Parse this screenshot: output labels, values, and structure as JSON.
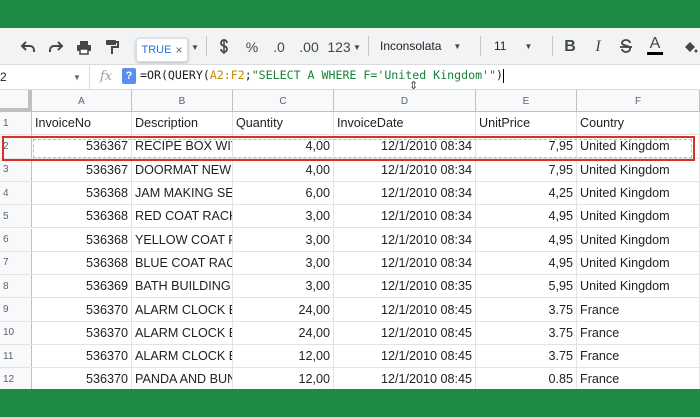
{
  "toolbar": {
    "chip_value": "TRUE",
    "chip_close": "×",
    "percent": "%",
    "dec_less": ".0",
    "dec_more": ".00",
    "number_format": "123",
    "font_name": "Inconsolata",
    "font_size": "11",
    "bold": "B",
    "italic": "I",
    "underline_letter": "A"
  },
  "formula_bar": {
    "name_box": "2",
    "fx": "fx",
    "help": "?",
    "formula_prefix": "=OR(QUERY(",
    "formula_range": "A2:F2",
    "formula_mid": ";",
    "formula_string": "\"SELECT A WHERE F='United Kingdom'\"",
    "formula_suffix": ")"
  },
  "columns": [
    "A",
    "B",
    "C",
    "D",
    "E",
    "F"
  ],
  "rows": [
    {
      "num": "1",
      "cells": [
        "InvoiceNo",
        "Description",
        "Quantity",
        "InvoiceDate",
        "UnitPrice",
        "Country"
      ]
    },
    {
      "num": "2",
      "cells": [
        "536367",
        "RECIPE BOX WIT",
        "4,00",
        "12/1/2010 08:34",
        "7,95",
        "United Kingdom"
      ]
    },
    {
      "num": "3",
      "cells": [
        "536367",
        "DOORMAT NEW",
        "4,00",
        "12/1/2010 08:34",
        "7,95",
        "United Kingdom"
      ]
    },
    {
      "num": "4",
      "cells": [
        "536368",
        "JAM MAKING SE",
        "6,00",
        "12/1/2010 08:34",
        "4,25",
        "United Kingdom"
      ]
    },
    {
      "num": "5",
      "cells": [
        "536368",
        "RED COAT RACK",
        "3,00",
        "12/1/2010 08:34",
        "4,95",
        "United Kingdom"
      ]
    },
    {
      "num": "6",
      "cells": [
        "536368",
        "YELLOW COAT R",
        "3,00",
        "12/1/2010 08:34",
        "4,95",
        "United Kingdom"
      ]
    },
    {
      "num": "7",
      "cells": [
        "536368",
        "BLUE COAT RACK",
        "3,00",
        "12/1/2010 08:34",
        "4,95",
        "United Kingdom"
      ]
    },
    {
      "num": "8",
      "cells": [
        "536369",
        "BATH BUILDING",
        "3,00",
        "12/1/2010 08:35",
        "5,95",
        "United Kingdom"
      ]
    },
    {
      "num": "9",
      "cells": [
        "536370",
        "ALARM CLOCK B",
        "24,00",
        "12/1/2010 08:45",
        "3.75",
        "France"
      ]
    },
    {
      "num": "10",
      "cells": [
        "536370",
        "ALARM CLOCK B",
        "24,00",
        "12/1/2010 08:45",
        "3.75",
        "France"
      ]
    },
    {
      "num": "11",
      "cells": [
        "536370",
        "ALARM CLOCK B",
        "12,00",
        "12/1/2010 08:45",
        "3.75",
        "France"
      ]
    },
    {
      "num": "12",
      "cells": [
        "536370",
        "PANDA AND BUN",
        "12,00",
        "12/1/2010 08:45",
        "0.85",
        "France"
      ]
    }
  ],
  "colors": {
    "accent_green": "#1f8a45",
    "selection_red": "#d93025",
    "range_highlight": "#c58a00",
    "string_highlight": "#188038"
  }
}
